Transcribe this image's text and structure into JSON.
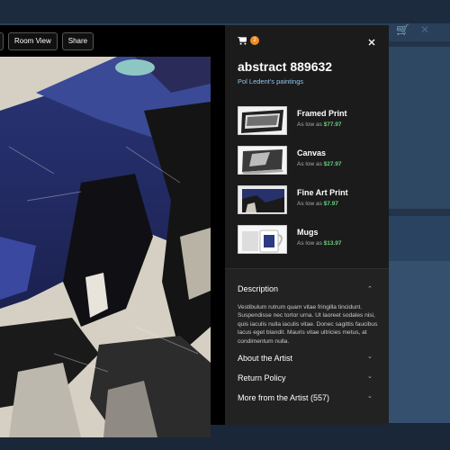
{
  "toolbar": {
    "room_view_label": "Room View",
    "share_label": "Share"
  },
  "cart": {
    "count": "2"
  },
  "product": {
    "title": "abstract 889632",
    "artist_link": "Pol Ledent's paintings"
  },
  "price_prefix": "As low as ",
  "options": [
    {
      "name": "Framed Print",
      "price": "$77.97"
    },
    {
      "name": "Canvas",
      "price": "$27.97"
    },
    {
      "name": "Fine Art Print",
      "price": "$7.97"
    },
    {
      "name": "Mugs",
      "price": "$13.97"
    }
  ],
  "accordion": {
    "description": {
      "title": "Description",
      "body": "Vestibulum rutrum quam vitae fringilla tincidunt. Suspendisse nec tortor urna. Ut laoreet sodales nisi, quis iaculis nulla iaculis vitae. Donec sagittis faucibus lacus eget blandit. Mauris vitae ultricies metus, at condimentum nulla."
    },
    "about_artist": {
      "title": "About the Artist"
    },
    "return_policy": {
      "title": "Return Policy"
    },
    "more_from_artist": {
      "title": "More from the Artist (557)"
    }
  },
  "colors": {
    "accent_price": "#66d07b",
    "badge": "#f08a24",
    "link": "#8fc7ef"
  }
}
